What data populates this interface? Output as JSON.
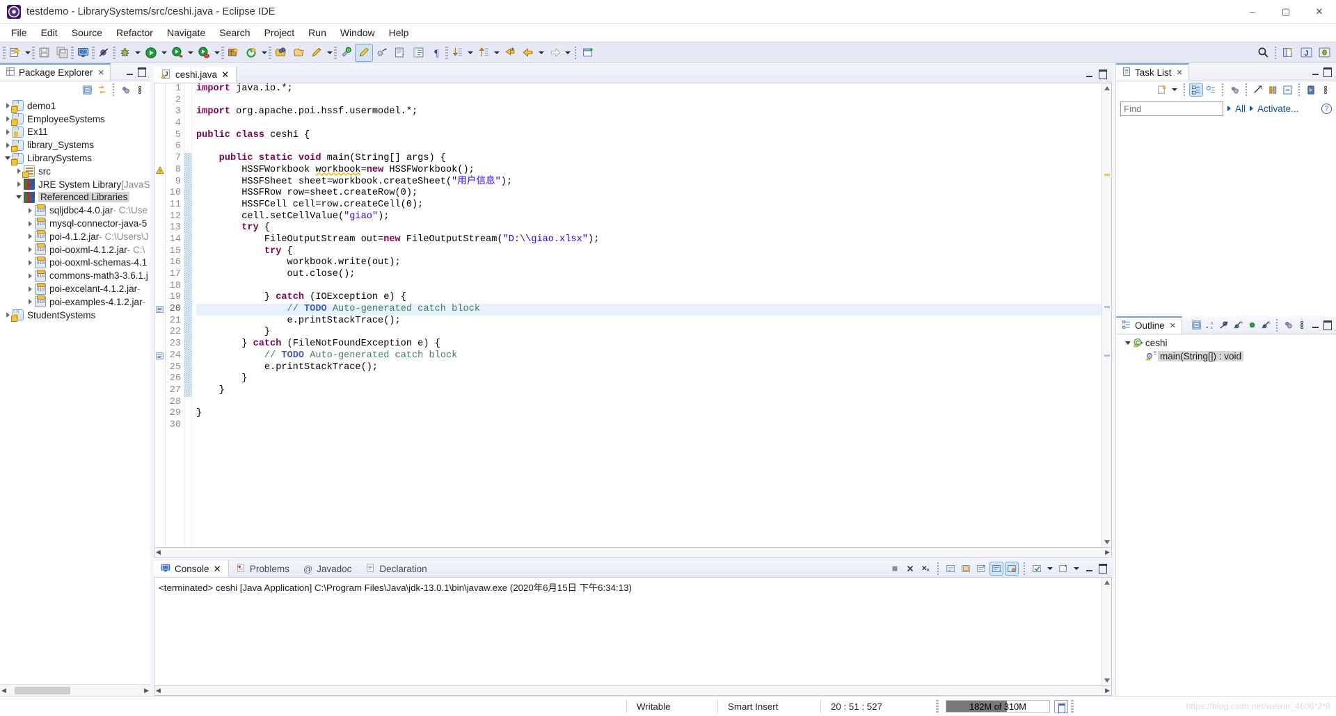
{
  "window": {
    "title": "testdemo - LibrarySystems/src/ceshi.java - Eclipse IDE",
    "app_icon": "eclipse-icon",
    "minimize": "–",
    "maximize": "▢",
    "close": "✕"
  },
  "menubar": {
    "items": [
      "File",
      "Edit",
      "Source",
      "Refactor",
      "Navigate",
      "Search",
      "Project",
      "Run",
      "Window",
      "Help"
    ]
  },
  "toolbar": {
    "left_icons": [
      "new-wizard-icon",
      "save-icon",
      "save-all-icon",
      "console-icon",
      "skip-breakpoints-icon",
      "debug-icon",
      "run-icon",
      "run-as-icon",
      "coverage-icon",
      "new-java-package-icon",
      "external-tools-icon",
      "open-type-icon",
      "open-task-icon",
      "edit-icon"
    ],
    "right_icons": [
      "search-icon",
      "link-icon",
      "perspective-java-icon",
      "perspective-open-icon"
    ],
    "mid_icons": [
      "toggle-mark-occurrences-icon",
      "toggle-annotations-icon",
      "show-whitespace-icon",
      "next-annotation-icon",
      "previous-annotation-icon",
      "back-icon",
      "forward-icon",
      "new-editor-icon"
    ]
  },
  "package_explorer": {
    "tab_label": "Package Explorer",
    "tab_icon": "package-explorer-icon",
    "close_glyph": "✕",
    "toolbar_icons": [
      "collapse-all-icon",
      "link-with-editor-icon",
      "view-menu-dots-icon",
      "view-menu-icon"
    ],
    "minimize_glyph": "–",
    "maximize_glyph": "▢",
    "tree": [
      {
        "label": "demo1",
        "sub": "",
        "icon": "java-project-icon",
        "indent": 0,
        "state": "collapsed",
        "selected": false
      },
      {
        "label": "EmployeeSystems",
        "sub": "",
        "icon": "java-project-icon",
        "indent": 0,
        "state": "collapsed",
        "selected": false
      },
      {
        "label": "Ex11",
        "sub": "",
        "icon": "project-icon",
        "indent": 0,
        "state": "collapsed",
        "selected": false
      },
      {
        "label": "library_Systems",
        "sub": "",
        "icon": "java-project-icon",
        "indent": 0,
        "state": "collapsed",
        "selected": false
      },
      {
        "label": "LibrarySystems",
        "sub": "",
        "icon": "java-project-icon",
        "indent": 0,
        "state": "expanded",
        "selected": false
      },
      {
        "label": "src",
        "sub": "",
        "icon": "source-folder-icon",
        "indent": 1,
        "state": "collapsed",
        "selected": false
      },
      {
        "label": "JRE System Library",
        "sub": " [JavaSE",
        "icon": "library-icon",
        "indent": 1,
        "state": "collapsed",
        "selected": false
      },
      {
        "label": "Referenced Libraries",
        "sub": "",
        "icon": "library-icon",
        "indent": 1,
        "state": "expanded",
        "selected": true
      },
      {
        "label": "sqljdbc4-4.0.jar",
        "sub": " - C:\\Use",
        "icon": "jar-icon",
        "indent": 2,
        "state": "collapsed",
        "selected": false
      },
      {
        "label": "mysql-connector-java-5",
        "sub": "",
        "icon": "jar-icon",
        "indent": 2,
        "state": "collapsed",
        "selected": false
      },
      {
        "label": "poi-4.1.2.jar",
        "sub": " - C:\\Users\\J",
        "icon": "jar-icon",
        "indent": 2,
        "state": "collapsed",
        "selected": false
      },
      {
        "label": "poi-ooxml-4.1.2.jar",
        "sub": " - C:\\",
        "icon": "jar-icon",
        "indent": 2,
        "state": "collapsed",
        "selected": false
      },
      {
        "label": "poi-ooxml-schemas-4.1",
        "sub": "",
        "icon": "jar-icon",
        "indent": 2,
        "state": "collapsed",
        "selected": false
      },
      {
        "label": "commons-math3-3.6.1.j",
        "sub": "",
        "icon": "jar-icon",
        "indent": 2,
        "state": "collapsed",
        "selected": false
      },
      {
        "label": "poi-excelant-4.1.2.jar",
        "sub": " - ",
        "icon": "jar-icon",
        "indent": 2,
        "state": "collapsed",
        "selected": false
      },
      {
        "label": "poi-examples-4.1.2.jar",
        "sub": " - ",
        "icon": "jar-icon",
        "indent": 2,
        "state": "collapsed",
        "selected": false
      },
      {
        "label": "StudentSystems",
        "sub": "",
        "icon": "java-project-icon",
        "indent": 0,
        "state": "collapsed",
        "selected": false
      }
    ]
  },
  "editor": {
    "tab_label": "ceshi.java",
    "tab_icon": "java-file-warning-icon",
    "close_glyph": "✕",
    "minimize_glyph": "–",
    "maximize_glyph": "▢",
    "current_line": 20,
    "lines": [
      {
        "n": 1,
        "tokens": [
          {
            "t": "import",
            "c": "kw"
          },
          {
            "t": " java.io.*;",
            "c": ""
          }
        ]
      },
      {
        "n": 2,
        "tokens": []
      },
      {
        "n": 3,
        "tokens": [
          {
            "t": "import",
            "c": "kw"
          },
          {
            "t": " org.apache.poi.hssf.usermodel.*;",
            "c": ""
          }
        ]
      },
      {
        "n": 4,
        "tokens": []
      },
      {
        "n": 5,
        "tokens": [
          {
            "t": "public class",
            "c": "kw"
          },
          {
            "t": " ceshi {",
            "c": ""
          }
        ]
      },
      {
        "n": 6,
        "tokens": []
      },
      {
        "n": 7,
        "tokens": [
          {
            "t": "    ",
            "c": ""
          },
          {
            "t": "public static void",
            "c": "kw"
          },
          {
            "t": " main(String[] args) {",
            "c": ""
          }
        ]
      },
      {
        "n": 8,
        "tokens": [
          {
            "t": "        HSSFWorkbook ",
            "c": ""
          },
          {
            "t": "workbook",
            "c": "warn"
          },
          {
            "t": "=",
            "c": ""
          },
          {
            "t": "new",
            "c": "kw"
          },
          {
            "t": " HSSFWorkbook();",
            "c": ""
          }
        ]
      },
      {
        "n": 9,
        "tokens": [
          {
            "t": "        HSSFSheet sheet=workbook.createSheet(",
            "c": ""
          },
          {
            "t": "\"用户信息\"",
            "c": "str"
          },
          {
            "t": ");",
            "c": ""
          }
        ]
      },
      {
        "n": 10,
        "tokens": [
          {
            "t": "        HSSFRow row=sheet.createRow(0);",
            "c": ""
          }
        ]
      },
      {
        "n": 11,
        "tokens": [
          {
            "t": "        HSSFCell cell=row.createCell(0);",
            "c": ""
          }
        ]
      },
      {
        "n": 12,
        "tokens": [
          {
            "t": "        cell.setCellValue(",
            "c": ""
          },
          {
            "t": "\"giao\"",
            "c": "str"
          },
          {
            "t": ");",
            "c": ""
          }
        ]
      },
      {
        "n": 13,
        "tokens": [
          {
            "t": "        ",
            "c": ""
          },
          {
            "t": "try",
            "c": "kw"
          },
          {
            "t": " {",
            "c": ""
          }
        ]
      },
      {
        "n": 14,
        "tokens": [
          {
            "t": "            FileOutputStream out=",
            "c": ""
          },
          {
            "t": "new",
            "c": "kw"
          },
          {
            "t": " FileOutputStream(",
            "c": ""
          },
          {
            "t": "\"D:\\\\giao.xlsx\"",
            "c": "str"
          },
          {
            "t": ");",
            "c": ""
          }
        ]
      },
      {
        "n": 15,
        "tokens": [
          {
            "t": "            ",
            "c": ""
          },
          {
            "t": "try",
            "c": "kw"
          },
          {
            "t": " {",
            "c": ""
          }
        ]
      },
      {
        "n": 16,
        "tokens": [
          {
            "t": "                workbook.write(out);",
            "c": ""
          }
        ]
      },
      {
        "n": 17,
        "tokens": [
          {
            "t": "                out.close();",
            "c": ""
          }
        ]
      },
      {
        "n": 18,
        "tokens": []
      },
      {
        "n": 19,
        "tokens": [
          {
            "t": "            } ",
            "c": ""
          },
          {
            "t": "catch",
            "c": "kw"
          },
          {
            "t": " (IOException e) {",
            "c": ""
          }
        ]
      },
      {
        "n": 20,
        "tokens": [
          {
            "t": "                ",
            "c": ""
          },
          {
            "t": "// ",
            "c": "cmt"
          },
          {
            "t": "TODO",
            "c": "todo"
          },
          {
            "t": " Auto-generated catch block",
            "c": "cmt"
          }
        ]
      },
      {
        "n": 21,
        "tokens": [
          {
            "t": "                e.printStackTrace();",
            "c": ""
          }
        ]
      },
      {
        "n": 22,
        "tokens": [
          {
            "t": "            }",
            "c": ""
          }
        ]
      },
      {
        "n": 23,
        "tokens": [
          {
            "t": "        } ",
            "c": ""
          },
          {
            "t": "catch",
            "c": "kw"
          },
          {
            "t": " (FileNotFoundException e) {",
            "c": ""
          }
        ]
      },
      {
        "n": 24,
        "tokens": [
          {
            "t": "            ",
            "c": ""
          },
          {
            "t": "// ",
            "c": "cmt"
          },
          {
            "t": "TODO",
            "c": "todo"
          },
          {
            "t": " Auto-generated catch block",
            "c": "cmt"
          }
        ]
      },
      {
        "n": 25,
        "tokens": [
          {
            "t": "            e.printStackTrace();",
            "c": ""
          }
        ]
      },
      {
        "n": 26,
        "tokens": [
          {
            "t": "        }",
            "c": ""
          }
        ]
      },
      {
        "n": 27,
        "tokens": [
          {
            "t": "    }",
            "c": ""
          }
        ]
      },
      {
        "n": 28,
        "tokens": []
      },
      {
        "n": 29,
        "tokens": [
          {
            "t": "}",
            "c": ""
          }
        ]
      },
      {
        "n": 30,
        "tokens": []
      }
    ]
  },
  "console": {
    "tabs": [
      {
        "label": "Console",
        "icon": "console-icon",
        "active": true,
        "close_glyph": "✕"
      },
      {
        "label": "Problems",
        "icon": "problems-icon",
        "active": false
      },
      {
        "label": "Javadoc",
        "icon": "javadoc-icon",
        "active": false
      },
      {
        "label": "Declaration",
        "icon": "declaration-icon",
        "active": false
      }
    ],
    "output": "<terminated> ceshi [Java Application] C:\\Program Files\\Java\\jdk-13.0.1\\bin\\javaw.exe (2020年6月15日 下午6:34:13)",
    "toolbar_icons": [
      "terminate-icon",
      "remove-launch-icon",
      "remove-all-icon",
      "open-console-icon",
      "pin-console-icon",
      "scroll-lock-icon",
      "word-wrap-icon",
      "show-console-icon",
      "display-selected-icon",
      "new-console-view-icon",
      "menu-icon"
    ],
    "minimize_glyph": "–",
    "maximize_glyph": "▢"
  },
  "task_list": {
    "tab_label": "Task List",
    "tab_icon": "task-list-icon",
    "close_glyph": "✕",
    "minimize_glyph": "–",
    "maximize_glyph": "▢",
    "toolbar_icons": [
      "new-task-icon",
      "new-task-dropdown-icon",
      "categorized-presentation-icon",
      "scheduled-presentation-icon",
      "focus-on-workweek-icon",
      "collapse-all-icon",
      "synchronize-changed-icon",
      "restore-tasks-icon",
      "view-menu-icon"
    ],
    "find_placeholder": "Find",
    "find_value": "",
    "filter_all": "All",
    "filter_activate": "Activate...",
    "help_glyph": "?"
  },
  "outline": {
    "tab_label": "Outline",
    "tab_icon": "outline-icon",
    "close_glyph": "✕",
    "minimize_glyph": "–",
    "maximize_glyph": "▢",
    "toolbar_icons": [
      "collapse-all-icon",
      "sort-icon",
      "hide-fields-icon",
      "hide-static-icon",
      "hide-non-public-icon",
      "hide-local-types-icon",
      "link-with-editor-icon",
      "view-menu-icon"
    ],
    "tree": [
      {
        "label": "ceshi",
        "indent": 0,
        "state": "expanded",
        "icon": "class-icon",
        "selected": false
      },
      {
        "label": "main(String[]) : void",
        "indent": 1,
        "state": "leaf",
        "icon": "method-static-icon",
        "selected": true
      }
    ]
  },
  "statusbar": {
    "writable": "Writable",
    "insert_mode": "Smart Insert",
    "position": "20 : 51 : 527",
    "heap_label": "182M of 310M",
    "heap_used_pct": 59,
    "trash_icon": "trash-icon",
    "watermark": "https://blog.csdn.net/weixin_4606*2*8"
  },
  "colors": {
    "accent": "#0b4f9e",
    "toolbar_bg": "#e6e9f5",
    "keyword": "#7f0055",
    "string": "#2a00ff",
    "comment": "#3f7f5f",
    "todo": "#3f5fbf",
    "selection": "#d6d6d6",
    "current_line": "#e8f0fb"
  }
}
